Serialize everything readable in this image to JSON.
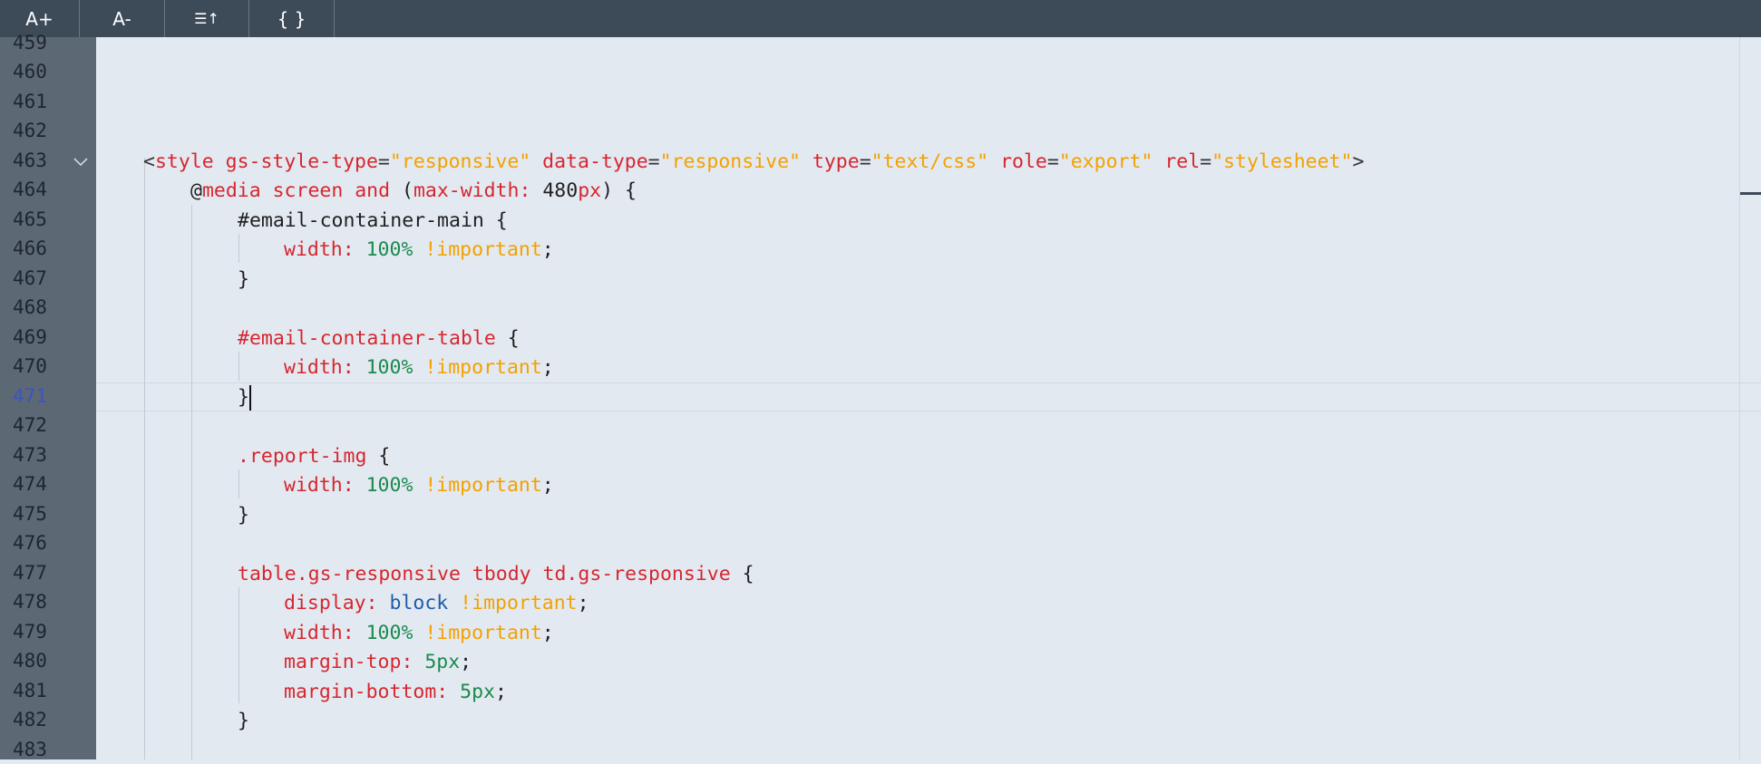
{
  "toolbar": {
    "font_increase": "A+",
    "font_decrease": "A-",
    "sort_icon_glyph": "☰↑",
    "format_label": "{ }"
  },
  "editor": {
    "active_line": "471",
    "gutter_lines": [
      "459",
      "460",
      "461",
      "462",
      "463",
      "464",
      "465",
      "466",
      "467",
      "468",
      "469",
      "470",
      "471",
      "472",
      "473",
      "474",
      "475",
      "476",
      "477",
      "478",
      "479",
      "480",
      "481",
      "482",
      "483"
    ],
    "code": {
      "l463": {
        "lt": "<",
        "tag": "style",
        "a1": "gs-style-type",
        "eq1": "=",
        "v1": "\"responsive\"",
        "a2": "data-type",
        "eq2": "=",
        "v2": "\"responsive\"",
        "a3": "type",
        "eq3": "=",
        "v3": "\"text/css\"",
        "a4": "role",
        "eq4": "=",
        "v4": "\"export\"",
        "a5": "rel",
        "eq5": "=",
        "v5": "\"stylesheet\"",
        "gt": ">"
      },
      "l464": {
        "at": "@",
        "media": "media screen and",
        "open": " (",
        "prop": "max-width:",
        "num": " 480",
        "unit": "px",
        "close": ") {"
      },
      "l465": {
        "sel": "#email-container-main",
        "brace": " {"
      },
      "l466": {
        "prop": "width:",
        "val": " 100%",
        "imp": " !important",
        "semi": ";"
      },
      "l467": {
        "brace": "}"
      },
      "l469": {
        "sel": "#email-container-table",
        "brace": " {"
      },
      "l470": {
        "prop": "width:",
        "val": " 100%",
        "imp": " !important",
        "semi": ";"
      },
      "l471": {
        "brace": "}"
      },
      "l473": {
        "sel": ".report-img",
        "brace": " {"
      },
      "l474": {
        "prop": "width:",
        "val": " 100%",
        "imp": " !important",
        "semi": ";"
      },
      "l475": {
        "brace": "}"
      },
      "l477": {
        "sel": "table.gs-responsive tbody td.gs-responsive",
        "brace": " {"
      },
      "l478": {
        "prop": "display:",
        "val": " block",
        "imp": " !important",
        "semi": ";"
      },
      "l479": {
        "prop": "width:",
        "val": " 100%",
        "imp": " !important",
        "semi": ";"
      },
      "l480": {
        "prop": "margin-top:",
        "val": " 5px",
        "semi": ";"
      },
      "l481": {
        "prop": "margin-bottom:",
        "val": " 5px",
        "semi": ";"
      },
      "l482": {
        "brace": "}"
      }
    }
  },
  "colors": {
    "toolbar_bg": "#3d4a58",
    "gutter_bg": "#5d6875",
    "editor_bg": "#e3e9f1",
    "keyword_red": "#d7262e",
    "string_orange": "#f3a100",
    "number_green": "#1a8a4d",
    "value_blue": "#1e5ca9",
    "active_line_number": "#3a55c2"
  }
}
